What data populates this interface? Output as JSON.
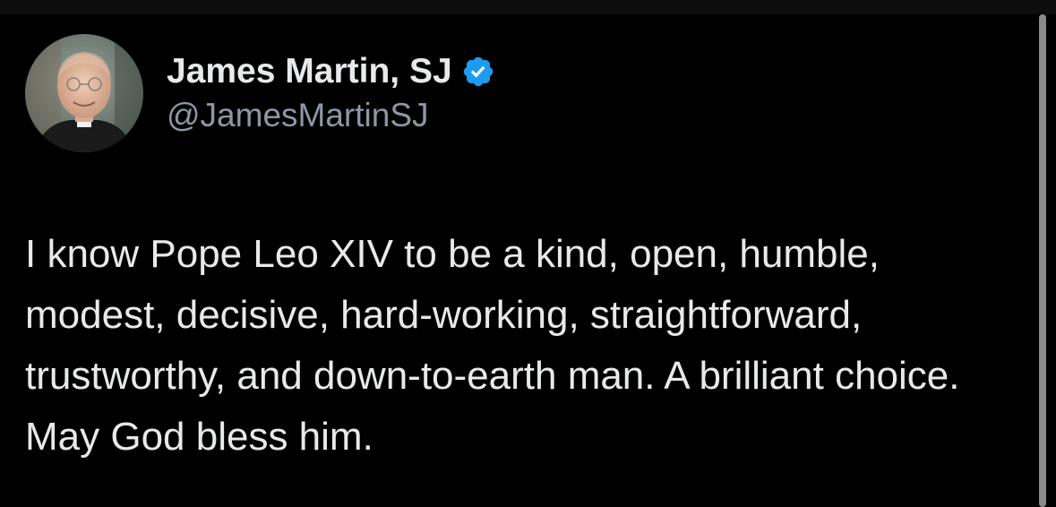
{
  "tweet": {
    "author": {
      "display_name": "James Martin, SJ",
      "handle": "@JamesMartinSJ",
      "verified": true,
      "verified_color": "#1d9bf0",
      "avatar_icon": "profile-photo"
    },
    "text": "I know Pope Leo XIV to be a kind, open, humble, modest, decisive, hard-working, straightforward, trustworthy, and down-to-earth man. A brilliant choice. May God bless him."
  },
  "theme": {
    "background": "#000000",
    "text_color": "#e7e9ea",
    "secondary_text_color": "#8b98a5",
    "scrollbar_color": "#8a8a8a"
  }
}
